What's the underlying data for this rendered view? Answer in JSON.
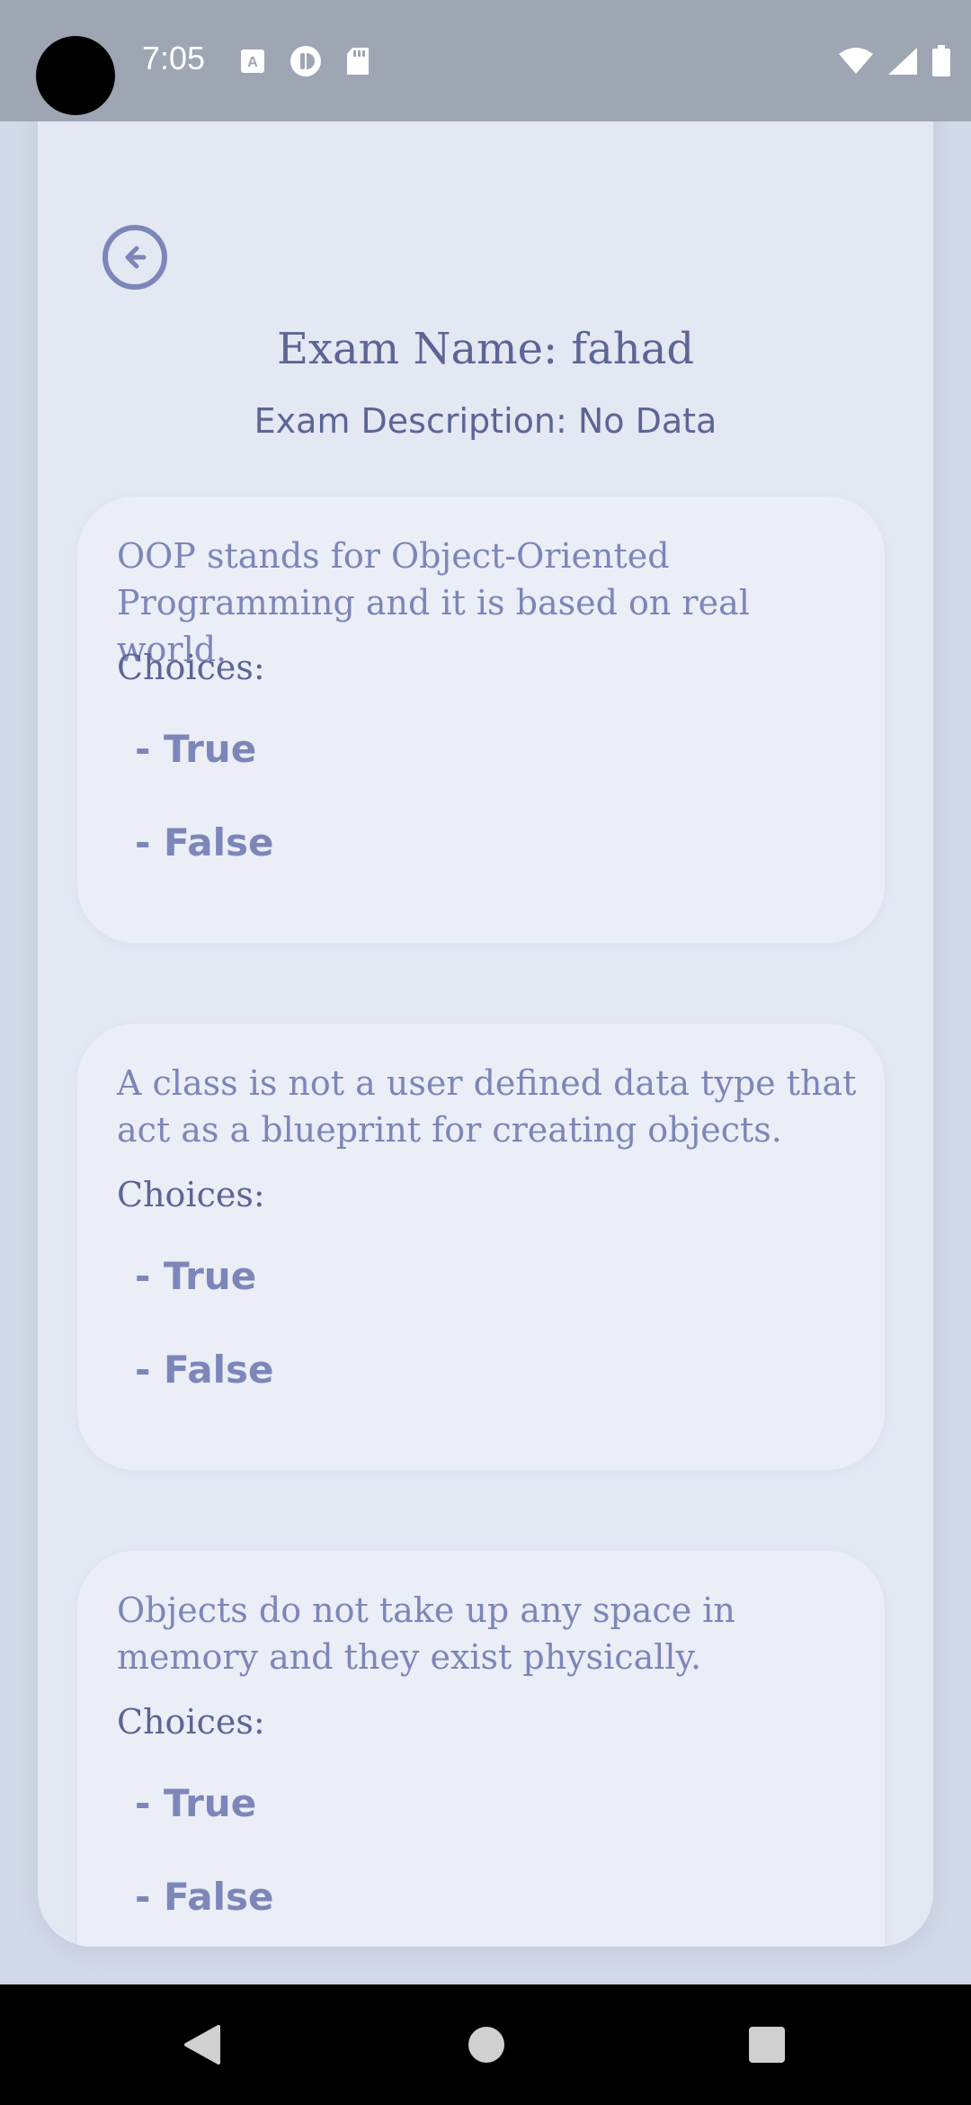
{
  "status_bar": {
    "time": "7:05"
  },
  "header": {
    "title": "Exam Name: fahad",
    "description": "Exam Description: No Data"
  },
  "questions": [
    {
      "text": "OOP stands for Object-Oriented Programming and it is based on real world.",
      "choices_label": "Choices:",
      "choices": [
        "- True",
        "- False"
      ]
    },
    {
      "text": "A class is not a user defined data type that act as a blueprint for creating objects.",
      "choices_label": "Choices:",
      "choices": [
        "- True",
        "- False"
      ]
    },
    {
      "text": "Objects do not take up any space in memory and they exist physically.",
      "choices_label": "Choices:",
      "choices": [
        "- True",
        "- False"
      ]
    }
  ],
  "icons": {
    "back": "arrow-left-circle-icon",
    "nav_back": "triangle-back-icon",
    "nav_home": "circle-home-icon",
    "nav_recents": "square-recents-icon"
  },
  "colors": {
    "accent": "#7d86b8",
    "text_dark": "#5d6595",
    "card_bg": "#ebeef7",
    "background": "#d2d9e8"
  }
}
